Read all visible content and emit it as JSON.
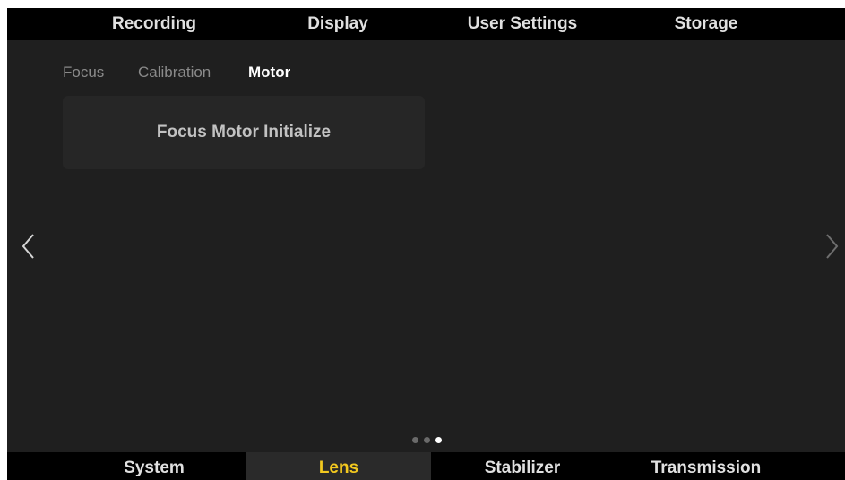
{
  "top_nav": {
    "tabs": [
      {
        "label": "Recording"
      },
      {
        "label": "Display"
      },
      {
        "label": "User Settings"
      },
      {
        "label": "Storage"
      }
    ]
  },
  "sub_tabs": [
    {
      "label": "Focus",
      "active": false
    },
    {
      "label": "Calibration",
      "active": false
    },
    {
      "label": "Motor",
      "active": true
    }
  ],
  "main": {
    "action_card_label": "Focus Motor Initialize"
  },
  "navigation": {
    "prev_icon": "chevron-left-icon",
    "next_icon": "chevron-right-icon"
  },
  "pager": {
    "total_pages": 3,
    "current_page": 3
  },
  "bottom_nav": {
    "tabs": [
      {
        "label": "System",
        "active": false
      },
      {
        "label": "Lens",
        "active": true
      },
      {
        "label": "Stabilizer",
        "active": false
      },
      {
        "label": "Transmission",
        "active": false
      }
    ]
  },
  "colors": {
    "background": "#1f1f1f",
    "bar_background": "#000000",
    "active_tab_text": "#f2c81f",
    "active_tab_background": "#2a2a2a",
    "card_background": "#262626"
  }
}
